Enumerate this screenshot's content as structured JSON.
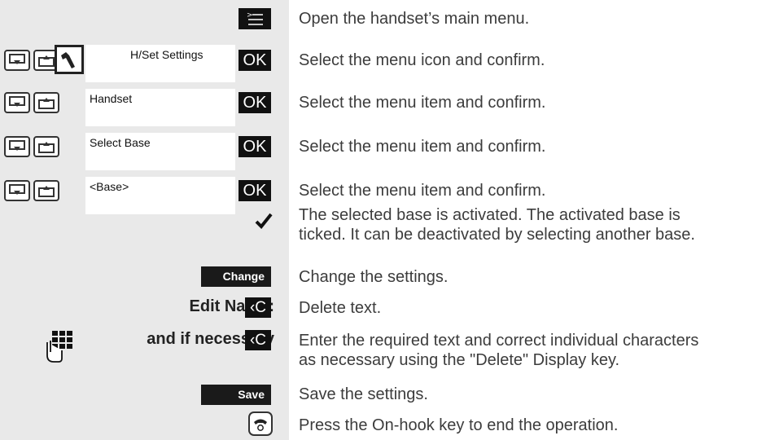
{
  "colors": {
    "left_column": "#e9e9e9",
    "key_background": "#111111",
    "text": "#3c3c3c"
  },
  "icons": {
    "menu": "main-menu-icon",
    "nav_down": "nav-down-key-icon",
    "nav_up": "nav-up-key-icon",
    "settings": "wrench-icon",
    "check": "checkmark-icon",
    "keypad": "keypad-icon",
    "onhook": "on-hook-key-icon"
  },
  "steps": [
    {
      "description": "Open the handset’s main menu."
    },
    {
      "display": "H/Set Settings",
      "ok": "OK",
      "description": "Select the menu icon and confirm."
    },
    {
      "display": "Handset",
      "ok": "OK",
      "description": "Select the menu item and confirm."
    },
    {
      "display": "Select Base",
      "ok": "OK",
      "description": "Select the menu item and confirm."
    },
    {
      "display": "<Base>",
      "ok": "OK",
      "description": "Select the menu item and confirm."
    },
    {
      "description_line1": "The selected base is activated. The activated base is",
      "description_line2": "ticked. It can be deactivated by selecting another base."
    },
    {
      "softkey": "Change",
      "description": "Change the settings."
    },
    {
      "label": "Edit Name:",
      "key": "‹C",
      "description": "Delete text."
    },
    {
      "label": "and if necessary",
      "key": "‹C",
      "description_line1": "Enter the required text and correct individual characters",
      "description_line2": "as necessary using the \"Delete\" Display key."
    },
    {
      "softkey": "Save",
      "description": "Save the settings."
    },
    {
      "description": "Press the On-hook key to end the operation."
    }
  ]
}
